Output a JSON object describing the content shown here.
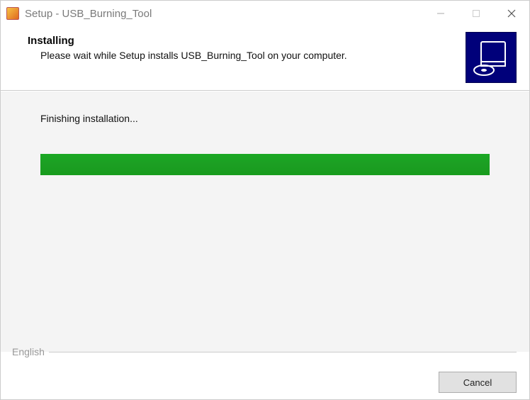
{
  "titlebar": {
    "title": "Setup - USB_Burning_Tool"
  },
  "header": {
    "heading": "Installing",
    "subtext": "Please wait while Setup installs USB_Burning_Tool on your computer."
  },
  "content": {
    "status": "Finishing installation...",
    "progress_percent": 100
  },
  "footer": {
    "language": "English",
    "cancel_label": "Cancel"
  }
}
